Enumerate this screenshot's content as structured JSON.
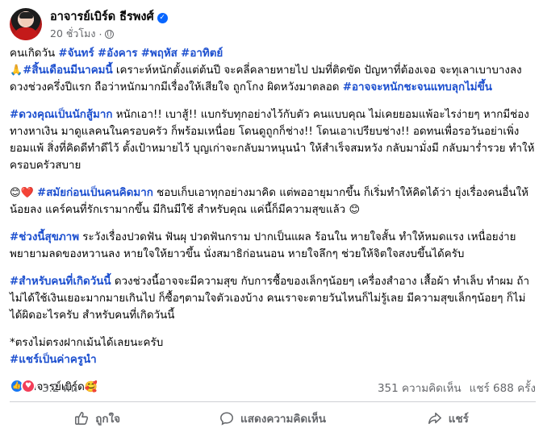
{
  "post": {
    "author": "อาจารย์เบิร์ด ธีรพงศ์",
    "time": "20 ชั่วโมง",
    "para1_text": "คนเกิดวัน ",
    "para1_tags": [
      "#จันทร์",
      "#อังคาร",
      "#พฤหัส",
      "#อาทิตย์"
    ],
    "para2_tag": "#สิ้นเดือนมีนาคมนี้",
    "para2_text": " เคราะห์หนักตั้งแต่ต้นปี จะคลี่คลายหายไป ปมที่ติดขัด ปัญหาที่ต้องเจอ จะทุเลาเบาบางลง ดวงช่วงครึ่งปีแรก ถือว่าหนักมากมีเรื่องให้เสียใจ ถูกโกง ผิดหวังมาตลอด ",
    "para2_tag2": "#อาจจะหนักชะจนแทบลุกไม่ขึ้น",
    "para3_tag": "#ดวงคุณเป็นนักสู้มาก",
    "para3_text": " หนักเอา!! เบาสู้!! แบกรับทุกอย่างไว้กับตัว คนแบบคุณ ไม่เคยยอมแพ้อะไรง่ายๆ หากมีช่องทางหาเงิน มาดูแลคนในครอบครัว ก็พร้อมเหนื่อย โดนดูถูกก็ช่าง!! โดนเอาเปรียบช่าง!! อดทนเพื่อรอวันอย่าเพิ่งยอมแพ้ สิ่งที่คิดดีทำดีไว้ ตั้งเป้าหมายไว้ บุญเก่าจะกลับมาหนุนนำ ให้สำเร็จสมหวัง กลับมามั่งมี กลับมาร่ำรวย ทำให้ครอบครัวสบาย",
    "para4_tag": "#สมัยก่อนเป็นคนคิดมาก",
    "para4_text": " ชอบเก็บเอาทุกอย่างมาคิด แต่พออายุมากขึ้น ก็เริ่มทำให้คิดได้ว่า ยุ่งเรื่องคนอื่นให้น้อยลง แคร์คนที่รักเรามากขึ้น มีกินมีใช้ สำหรับคุณ แค่นี้ก็มีความสุขแล้ว ",
    "para5_tag": "#ช่วงนี้สุขภาพ",
    "para5_text": " ระวังเรื่องปวดฟัน ฟันผุ ปวดฟันกราม ปากเป็นแผล ร้อนใน หายใจสั้น ทำให้หมดแรง เหนื่อยง่าย พยายามลดของหวานลง หายใจให้ยาวขึ้น นั่งสมาธิก่อนนอน หายใจลึกๆ ช่วยให้จิตใจสงบขึ้นได้ครับ",
    "para6_tag": "#สำหรับคนที่เกิดวันนี้",
    "para6_text": " ดวงช่วงนี้อาจจะมีความสุข กับการซื้อของเล็กๆน้อยๆ เครื่องสำอาง เสื้อผ้า ทำเล็บ ทำผม ถ้าไม่ได้ใช้เงินเยอะมากมายเกินไป ก็ซื้อๆตามใจตัวเองบ้าง คนเราจะตายวันไหนก็ไม่รู้เลย มีความสุขเล็กๆน้อยๆ ก็ไม่ได้ผิดอะไรครับ สำหรับคนที่เกิดวันนี้",
    "para7_text": "*ตรงไม่ตรงฝากเม้นได้เลยนะครับ",
    "para7_tag": "#แชร์เป็นค่าครูนำ",
    "credit": "Cr.อาจารย์เบิร์ด"
  },
  "emoji": {
    "pray": "🙏",
    "smile_heart": "😊❤️",
    "smile": "😊",
    "hug": "🥰"
  },
  "stats": {
    "reactions": "3.2 พัน",
    "comments": "351 ความคิดเห็น",
    "shares": "แชร์ 688 ครั้ง"
  },
  "actions": {
    "like": "ถูกใจ",
    "comment": "แสดงความคิดเห็น",
    "share": "แชร์"
  },
  "colors": {
    "hashtag": "#1c4fcf",
    "accent": "#0866ff",
    "secondary_text": "#65676b"
  }
}
